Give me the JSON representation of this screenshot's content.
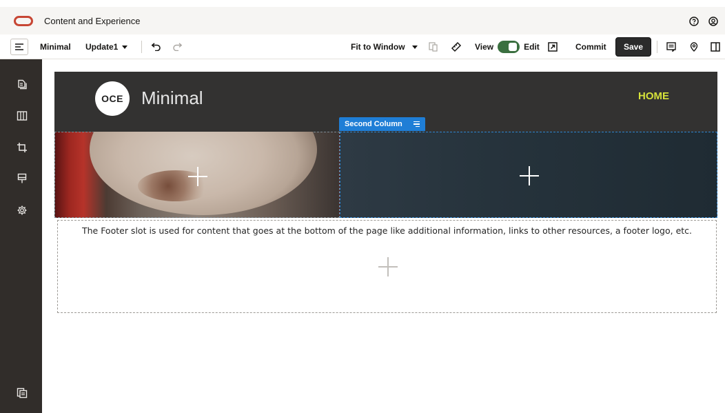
{
  "titlebar": {
    "app_title": "Content and Experience",
    "icons": [
      "help-icon",
      "user-icon"
    ]
  },
  "toolbar": {
    "site_name": "Minimal",
    "update_name": "Update1",
    "zoom_label": "Fit to Window",
    "view_label": "View",
    "edit_label": "Edit",
    "mode_toggle_on": "Edit",
    "commit_label": "Commit",
    "save_label": "Save"
  },
  "sidebar": {
    "items": [
      "pages-icon",
      "layout-columns-icon",
      "crop-icon",
      "theme-icon",
      "settings-icon"
    ],
    "bottom_item": "site-properties-icon"
  },
  "page": {
    "logo_text": "OCE",
    "site_title": "Minimal",
    "nav_home": "HOME",
    "column_label": "Second Column",
    "footer_text": "The Footer slot is used for content that goes at the bottom of the page like additional information, links to other resources, a footer logo, etc."
  },
  "colors": {
    "oracle_red": "#c74634",
    "toggle_on": "#3a6f3f",
    "selection_blue": "#1f7ed6",
    "nav_accent": "#d6e23a",
    "sidebar_bg": "#312d2a",
    "header_bg": "#333231"
  }
}
